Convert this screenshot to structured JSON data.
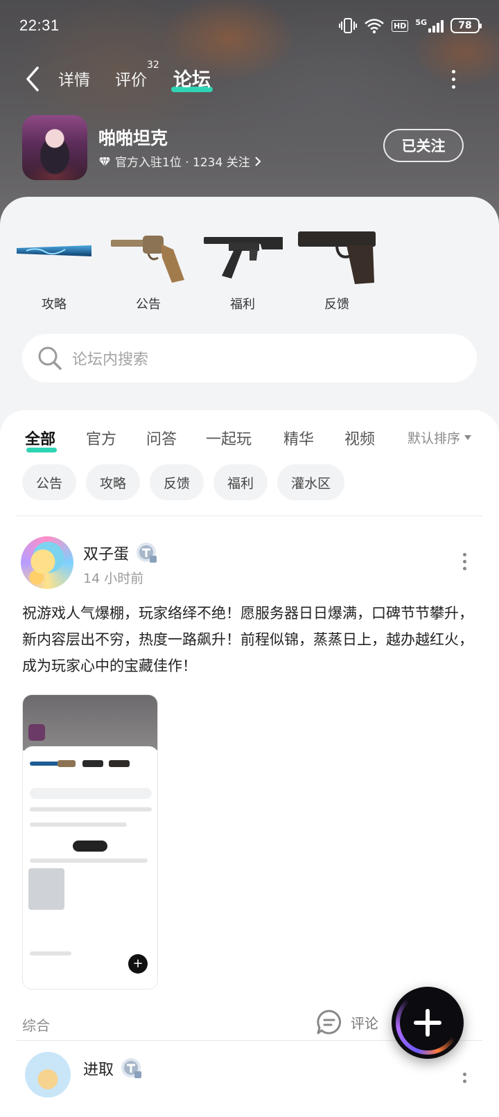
{
  "status_bar": {
    "time": "22:31",
    "network": "5G",
    "hd": "HD",
    "battery": "78"
  },
  "nav": {
    "tabs": [
      {
        "label": "详情"
      },
      {
        "label": "评价",
        "count": "32"
      },
      {
        "label": "论坛"
      }
    ],
    "active_tab": "论坛"
  },
  "app": {
    "name": "啪啪坦克",
    "meta": "官方入驻1位 · 1234 关注",
    "follow_label": "已关注"
  },
  "quick_links": [
    {
      "label": "攻略",
      "icon": "bat-icon"
    },
    {
      "label": "公告",
      "icon": "revolver-icon"
    },
    {
      "label": "福利",
      "icon": "rifle-icon"
    },
    {
      "label": "反馈",
      "icon": "pistol-icon"
    }
  ],
  "search": {
    "placeholder": "论坛内搜索"
  },
  "filter_tabs": [
    "全部",
    "官方",
    "问答",
    "一起玩",
    "精华",
    "视频"
  ],
  "active_filter": "全部",
  "sort_label": "默认排序",
  "chips": [
    "公告",
    "攻略",
    "反馈",
    "福利",
    "灌水区"
  ],
  "posts": [
    {
      "author": "双子蛋",
      "time": "14 小时前",
      "text": "祝游戏人气爆棚，玩家络绎不绝！愿服务器日日爆满，口碑节节攀升，新内容层出不穷，热度一路飙升！前程似锦，蒸蒸日上，越办越红火，成为玩家心中的宝藏佳作！",
      "tag": "综合",
      "comment_label": "评论"
    },
    {
      "author": "进取"
    }
  ],
  "colors": {
    "accent": "#2fd4b4",
    "fab": "#0c0c10"
  }
}
